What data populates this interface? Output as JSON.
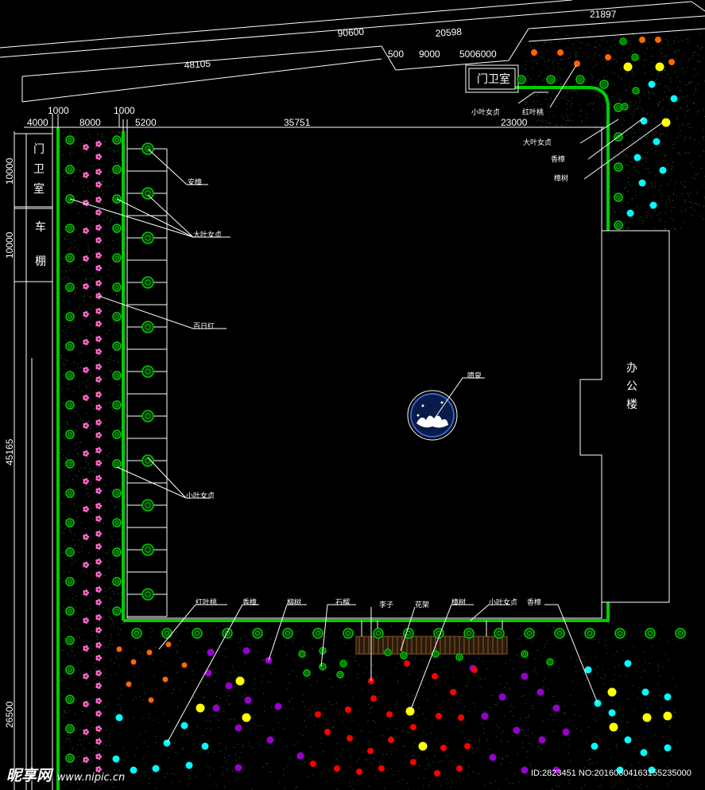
{
  "dimensions": {
    "road_top_right": "21897",
    "road_top_mid": "90600",
    "d_20598": "20598",
    "d_48105": "48105",
    "d_500a": "500",
    "d_9000": "9000",
    "d_500_6000": "5006000",
    "d_1000a": "1000",
    "d_1000b": "1000",
    "d_4000": "4000",
    "d_8000": "8000",
    "d_5200": "5200",
    "d_35751": "35751",
    "d_23000": "23000",
    "d_10000a": "10000",
    "d_10000b": "10000",
    "d_45165": "45165",
    "d_26500": "26500"
  },
  "rooms": {
    "guard_top": "门卫室",
    "guard_left_1": "门",
    "guard_left_2": "卫",
    "guard_left_3": "室",
    "shed_1": "车",
    "shed_2": "棚",
    "office_1": "办",
    "office_2": "公",
    "office_3": "楼"
  },
  "labels": {
    "xiaoye_top": "小叶女贞",
    "hongyetao_top": "红叶桃",
    "daye_right": "大叶女贞",
    "xiangzhang_right": "香樟",
    "zhangshu_right": "樟树",
    "anshu_left": "安樟",
    "daye_left": "大叶女贞",
    "bairihong": "百日红",
    "fountain": "喷泉",
    "xiaoye_left": "小叶女贞",
    "hongyetao_bot": "红叶桃",
    "xiangshu_bot": "香樟",
    "liushu": "柳树",
    "shiliu": "石榴",
    "lizi": "李子",
    "huajia": "花架",
    "zhangshu_bot": "樟树",
    "xiaoye_bot": "小叶女贞",
    "xiangzhang_bot": "香樟"
  },
  "watermark": {
    "logo": "昵享网",
    "url": "www.nipic.cn",
    "id": "ID:2823451 NO:20160604163155235000"
  },
  "colors": {
    "green_tree": "#00cc00",
    "pink_flower": "#ff66cc",
    "yellow": "#ffff00",
    "cyan": "#00ffff",
    "purple": "#9900cc",
    "red": "#ff0000",
    "orange_dot": "#ff6600"
  }
}
